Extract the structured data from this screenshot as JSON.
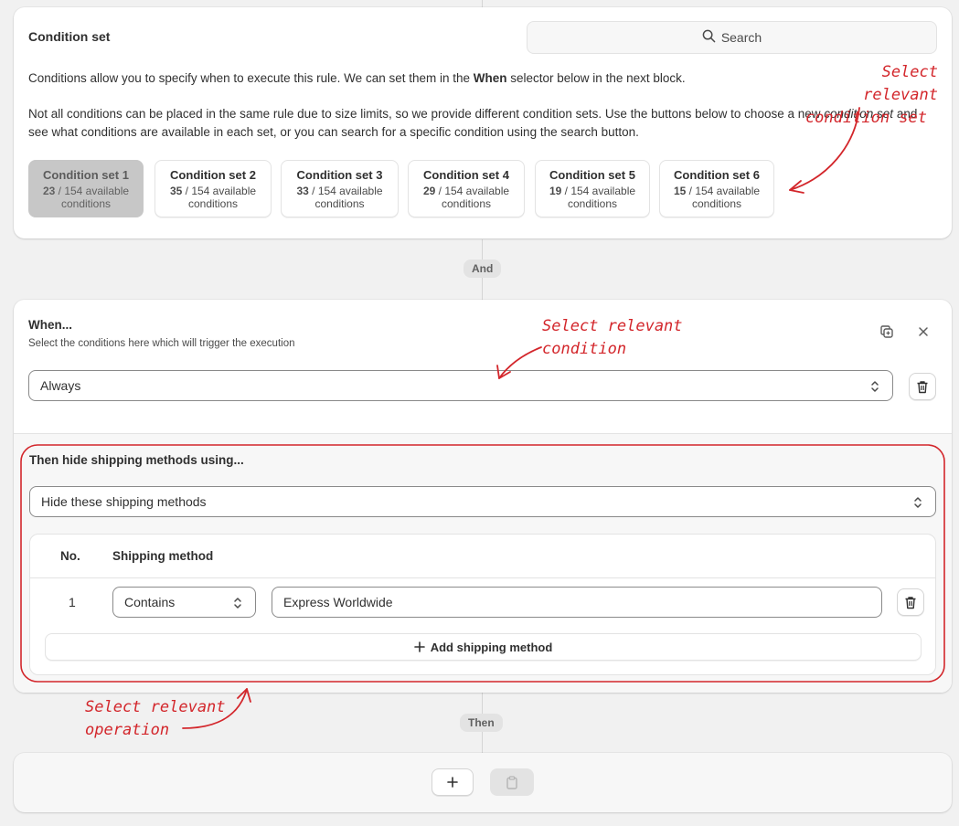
{
  "condition_set": {
    "title": "Condition set",
    "search_label": "Search",
    "intro_pre": "Conditions allow you to specify when to execute this rule. We can set them in the ",
    "intro_bold": "When",
    "intro_post": " selector below in the next block.",
    "note_pre": "Not all conditions can be placed in the same rule due to size limits, so we provide different condition sets. Use the buttons below to choose a new ",
    "note_em": "condition set",
    "note_post": " and see what conditions are available in each set, or you can search for a specific condition using the search button.",
    "sets": [
      {
        "name": "Condition set 1",
        "available": "23",
        "total_text": " / 154 available",
        "suffix": "conditions",
        "active": true
      },
      {
        "name": "Condition set 2",
        "available": "35",
        "total_text": " / 154 available",
        "suffix": "conditions",
        "active": false
      },
      {
        "name": "Condition set 3",
        "available": "33",
        "total_text": " / 154 available",
        "suffix": "conditions",
        "active": false
      },
      {
        "name": "Condition set 4",
        "available": "29",
        "total_text": " / 154 available",
        "suffix": "conditions",
        "active": false
      },
      {
        "name": "Condition set 5",
        "available": "19",
        "total_text": " / 154 available",
        "suffix": "conditions",
        "active": false
      },
      {
        "name": "Condition set 6",
        "available": "15",
        "total_text": " / 154 available",
        "suffix": "conditions",
        "active": false
      }
    ]
  },
  "connector_and": "And",
  "when": {
    "title": "When...",
    "subtitle": "Select the conditions here which will trigger the execution",
    "selected": "Always"
  },
  "then_block": {
    "title": "Then hide shipping methods using...",
    "operation_selected": "Hide these shipping methods",
    "table": {
      "col_no": "No.",
      "col_method": "Shipping method",
      "rows": [
        {
          "no": "1",
          "match": "Contains",
          "value": "Express Worldwide"
        }
      ],
      "add_label": "Add shipping method"
    }
  },
  "connector_then": "Then",
  "annotations": {
    "condition_set": [
      "Select relevant",
      "condition set"
    ],
    "condition": [
      "Select relevant",
      "condition"
    ],
    "operation": [
      "Select relevant",
      "operation"
    ]
  },
  "colors": {
    "annotation": "#d3262b",
    "active_set": "#c7c7c7",
    "page_bg": "#f1f1f1"
  },
  "icons": [
    "search-icon",
    "copy-icon",
    "close-icon",
    "trash-icon",
    "chevron-updown-icon",
    "plus-icon",
    "clipboard-icon"
  ]
}
